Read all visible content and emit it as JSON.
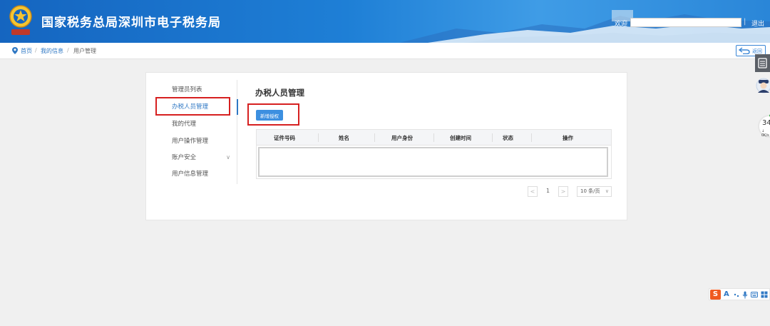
{
  "header": {
    "title": "国家税务总局深圳市电子税务局",
    "welcome": "欢迎",
    "user_value": "",
    "separator": "|",
    "logout": "退出",
    "colors": {
      "primary": "#1565c0",
      "accent": "#3f9ce6"
    },
    "emblem_icon": "tax-emblem-icon"
  },
  "breadcrumb": {
    "home": "首页",
    "level2": "我的信息",
    "current": "用户管理",
    "separator": "/",
    "back": "返回"
  },
  "sidebar": {
    "items": [
      {
        "label": "管理员列表"
      },
      {
        "label": "办税人员管理",
        "active": true
      },
      {
        "label": "我的代理"
      },
      {
        "label": "用户操作管理"
      },
      {
        "label": "账户安全",
        "has_children": true,
        "chevron": "∨"
      },
      {
        "label": "用户信息管理"
      }
    ]
  },
  "panel": {
    "title": "办税人员管理",
    "add_button": "新增授权",
    "table": {
      "columns": [
        "证件号码",
        "姓名",
        "用户身份",
        "创建时间",
        "状态",
        "操作"
      ],
      "rows": []
    },
    "pagination": {
      "prev": "<",
      "page": "1",
      "next": ">",
      "page_size": "10 条/页",
      "chevron": "∨"
    }
  },
  "widgets": {
    "gauge_percent": "34",
    "gauge_percent_sign": "%",
    "gauge_speed": "↓ 0K/s",
    "gauge_color": "#3bb54a",
    "ime_logo": "S",
    "ime_letter": "A",
    "highlight_color": "#d62020"
  }
}
